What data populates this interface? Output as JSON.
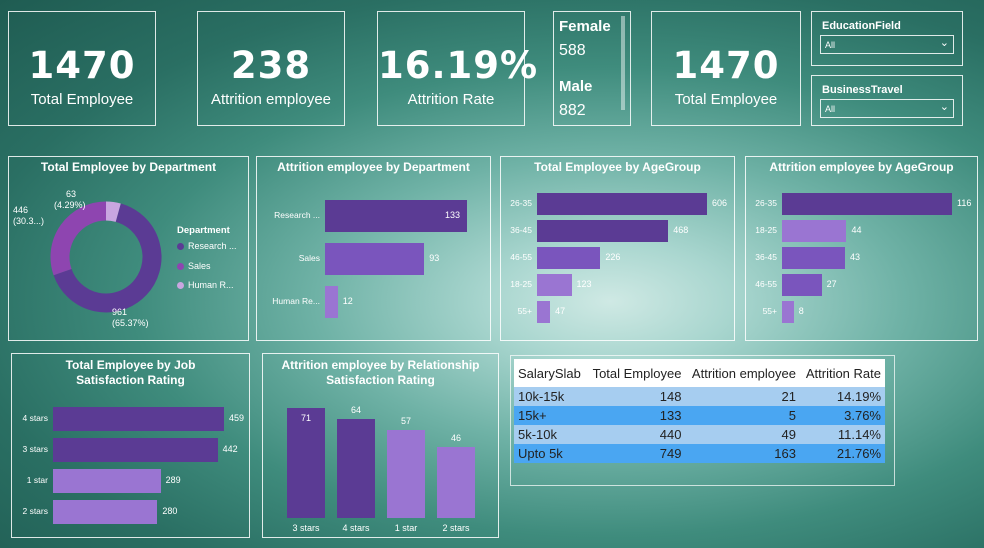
{
  "kpis": [
    {
      "value": "1470",
      "label": "Total Employee"
    },
    {
      "value": "238",
      "label": "Attrition employee"
    },
    {
      "value": "16.19%",
      "label": "Attrition Rate"
    },
    {
      "value": "1470",
      "label": "Total Employee"
    }
  ],
  "gender": {
    "female_label": "Female",
    "female_value": "588",
    "male_label": "Male",
    "male_value": "882"
  },
  "slicers": [
    {
      "title": "EducationField",
      "value": "All"
    },
    {
      "title": "BusinessTravel",
      "value": "All"
    }
  ],
  "colors": {
    "dark_purple": "#5b3b94",
    "mid_purple": "#7a55bd",
    "light_purple": "#9a75d2",
    "pale_purple": "#c9a6e0"
  },
  "chart_data": [
    {
      "type": "pie",
      "title": "Total Employee by Department",
      "legend_title": "Department",
      "legend_position": "right",
      "categories": [
        "Research ...",
        "Sales",
        "Human R..."
      ],
      "values": [
        961,
        446,
        63
      ],
      "labels": [
        {
          "line1": "961",
          "line2": "(65.37%)"
        },
        {
          "line1": "446",
          "line2": "(30.3...)"
        },
        {
          "line1": "63",
          "line2": "(4.29%)"
        }
      ],
      "colors": [
        "#5b3b94",
        "#8e45b0",
        "#c9a6e0"
      ]
    },
    {
      "type": "bar",
      "orientation": "horizontal",
      "title": "Attrition employee by Department",
      "categories": [
        "Research ...",
        "Sales",
        "Human Re..."
      ],
      "values": [
        133,
        93,
        12
      ]
    },
    {
      "type": "bar",
      "orientation": "horizontal",
      "title": "Total Employee by AgeGroup",
      "categories": [
        "26-35",
        "36-45",
        "46-55",
        "18-25",
        "55+"
      ],
      "values": [
        606,
        468,
        226,
        123,
        47
      ]
    },
    {
      "type": "bar",
      "orientation": "horizontal",
      "title": "Attrition employee by AgeGroup",
      "categories": [
        "26-35",
        "18-25",
        "36-45",
        "46-55",
        "55+"
      ],
      "values": [
        116,
        44,
        43,
        27,
        8
      ]
    },
    {
      "type": "bar",
      "orientation": "horizontal",
      "title": "Total Employee by Job Satisfaction Rating",
      "categories": [
        "4 stars",
        "3 stars",
        "1 star",
        "2 stars"
      ],
      "values": [
        459,
        442,
        289,
        280
      ]
    },
    {
      "type": "bar",
      "orientation": "vertical",
      "title": "Attrition employee by Relationship Satisfaction Rating",
      "categories": [
        "3 stars",
        "4 stars",
        "1 star",
        "2 stars"
      ],
      "values": [
        71,
        64,
        57,
        46
      ]
    },
    {
      "type": "table",
      "columns": [
        "SalarySlab",
        "Total Employee",
        "Attrition employee",
        "Attrition Rate"
      ],
      "rows": [
        [
          "10k-15k",
          "148",
          "21",
          "14.19%"
        ],
        [
          "15k+",
          "133",
          "5",
          "3.76%"
        ],
        [
          "5k-10k",
          "440",
          "49",
          "11.14%"
        ],
        [
          "Upto 5k",
          "749",
          "163",
          "21.76%"
        ]
      ]
    }
  ]
}
